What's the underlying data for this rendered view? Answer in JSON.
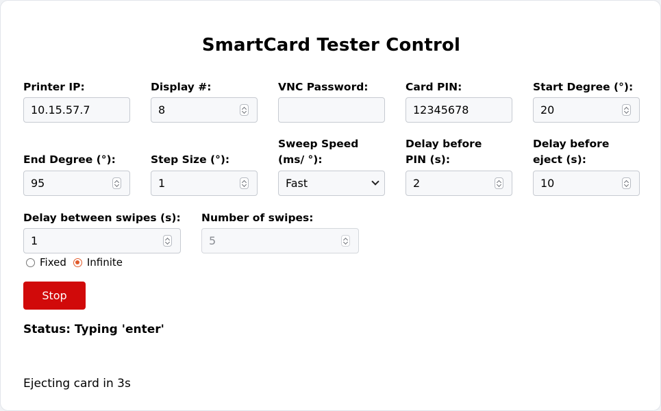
{
  "title": "SmartCard Tester Control",
  "fields": {
    "printer_ip": {
      "label": "Printer IP:",
      "value": "10.15.57.7"
    },
    "display": {
      "label": "Display #:",
      "value": "8"
    },
    "vnc_password": {
      "label": "VNC Password:",
      "value": ""
    },
    "card_pin": {
      "label": "Card PIN:",
      "value": "12345678"
    },
    "start_degree": {
      "label": "Start Degree (°):",
      "value": "20"
    },
    "end_degree": {
      "label": "End Degree (°):",
      "value": "95"
    },
    "step_size": {
      "label": "Step Size (°):",
      "value": "1"
    },
    "sweep_speed": {
      "label": "Sweep Speed (ms/ °):",
      "value": "Fast"
    },
    "delay_before_pin": {
      "label": "Delay before PIN (s):",
      "value": "2"
    },
    "delay_before_eject": {
      "label": "Delay before eject (s):",
      "value": "10"
    },
    "delay_between_swipes": {
      "label": "Delay between swipes (s):",
      "value": "1"
    },
    "number_of_swipes": {
      "label": "Number of swipes:",
      "value": "5"
    }
  },
  "swipe_mode": {
    "options": [
      "Fixed",
      "Infinite"
    ],
    "selected": "Infinite"
  },
  "stop_label": "Stop",
  "status_text": "Status: Typing 'enter'",
  "message": "Ejecting card in 3s",
  "colors": {
    "stop_button": "#d10a0a",
    "radio_accent": "#e05a2b"
  }
}
